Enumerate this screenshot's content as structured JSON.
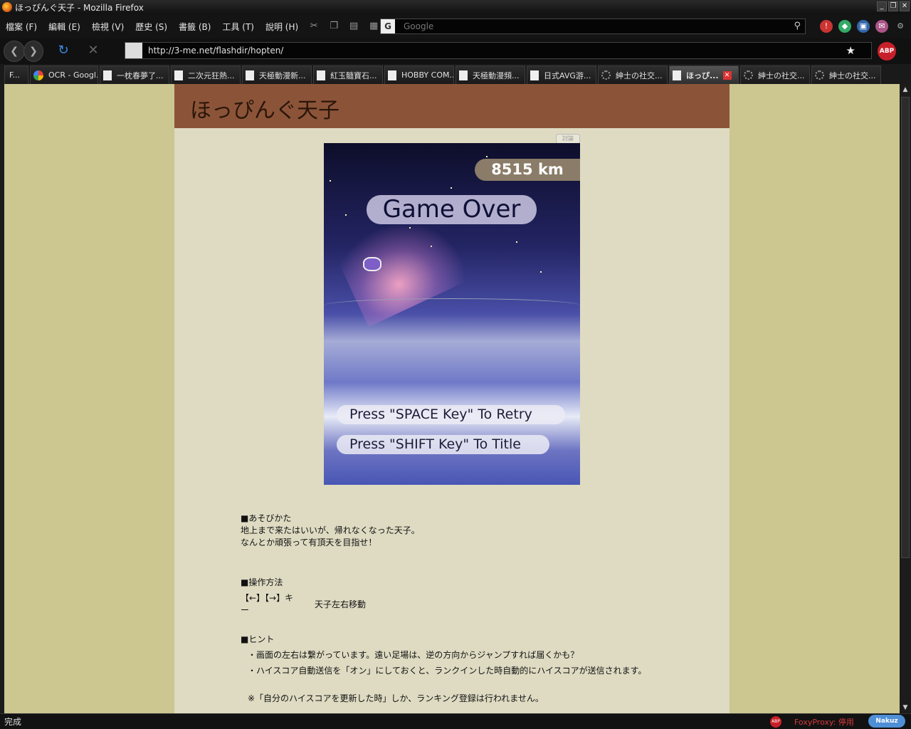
{
  "window": {
    "title": "ほっぴんぐ天子 - Mozilla Firefox",
    "controls": [
      "_",
      "❐",
      "✕"
    ]
  },
  "menu": {
    "items": [
      "檔案 (F)",
      "編輯 (E)",
      "檢視 (V)",
      "歷史 (S)",
      "書籤 (B)",
      "工具 (T)",
      "說明 (H)"
    ],
    "search_placeholder": "Google"
  },
  "nav": {
    "url": "http://3-me.net/flashdir/hopten/"
  },
  "tabs": [
    {
      "label": "F...",
      "icon": "page-icon"
    },
    {
      "label": "OCR - Googl...",
      "icon": "google-icon"
    },
    {
      "label": "一枕春夢了...",
      "icon": "page-icon"
    },
    {
      "label": "二次元狂熱...",
      "icon": "page-icon"
    },
    {
      "label": "天極動漫新...",
      "icon": "page-icon"
    },
    {
      "label": "紅玉髓寶石...",
      "icon": "page-icon"
    },
    {
      "label": "HOBBY COM...",
      "icon": "page-icon"
    },
    {
      "label": "天極動漫頻...",
      "icon": "page-icon"
    },
    {
      "label": "日式AVG游...",
      "icon": "page-icon"
    },
    {
      "label": "紳士の社交...",
      "icon": "loading-icon"
    },
    {
      "label": "ほっぴ...",
      "icon": "page-icon",
      "active": true
    },
    {
      "label": "紳士の社交...",
      "icon": "loading-icon"
    },
    {
      "label": "紳士の社交...",
      "icon": "loading-icon"
    }
  ],
  "page": {
    "header_title": "ほっぴんぐ天子",
    "flash_tag": "討論",
    "game": {
      "distance": "8515 km",
      "game_over": "Game Over",
      "retry": "Press \"SPACE Key\" To Retry",
      "title": "Press \"SHIFT Key\"  To Title"
    },
    "how_to_play": {
      "heading": "■あそびかた",
      "line1": "地上まで来たはいいが、帰れなくなった天子。",
      "line2": "なんとか頑張って有頂天を目指せ！"
    },
    "controls": {
      "heading": "■操作方法",
      "key": "【←】【→】キー",
      "desc": "天子左右移動"
    },
    "hints": {
      "heading": "■ヒント",
      "hint1": "・画面の左右は繋がっています。遠い足場は、逆の方向からジャンプすれば届くかも？",
      "hint2": "・ハイスコア自動送信を「オン」にしておくと、ランクインした時自動的にハイスコアが送信されます。",
      "hint3": "※「自分のハイスコアを更新した時」しか、ランキング登録は行われません。"
    }
  },
  "status": {
    "text": "完成",
    "foxyproxy": "FoxyProxy: 停用",
    "nakuz": "Nakuz"
  },
  "colors": {
    "page_bg": "#ccc690",
    "column_bg": "#dedbc2",
    "header_bg": "#8b5439"
  }
}
